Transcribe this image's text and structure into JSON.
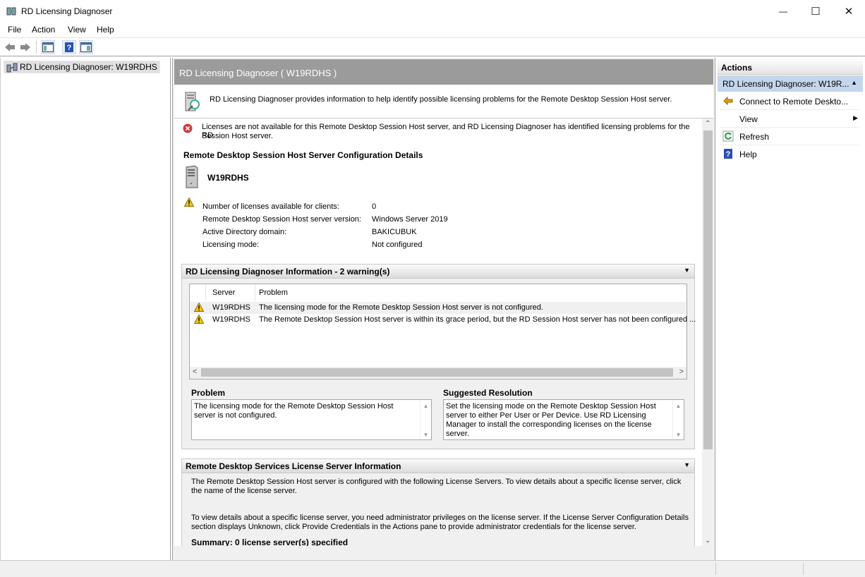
{
  "window": {
    "title": "RD Licensing Diagnoser",
    "minimize": "—",
    "maximize": "☐",
    "close": "✕"
  },
  "menu": [
    "File",
    "Action",
    "View",
    "Help"
  ],
  "tree": {
    "item": "RD Licensing Diagnoser: W19RDHS"
  },
  "center": {
    "header": "RD Licensing Diagnoser ( W19RDHS )",
    "intro": "RD Licensing Diagnoser provides information to help identify possible licensing problems for the Remote Desktop Session Host server.",
    "error_line1": "Licenses are not available for this Remote Desktop Session Host server, and RD Licensing Diagnoser has identified licensing problems for the RD",
    "error_line2": "Session Host server.",
    "config_title": "Remote Desktop Session Host Server Configuration Details",
    "server_name": "W19RDHS",
    "details": [
      {
        "label": "Number of licenses available for clients:",
        "value": "0"
      },
      {
        "label": "Remote Desktop Session Host server version:",
        "value": "Windows Server 2019"
      },
      {
        "label": "Active Directory domain:",
        "value": "BAKICUBUK"
      },
      {
        "label": "Licensing mode:",
        "value": "Not configured"
      }
    ],
    "diag": {
      "title": "RD Licensing Diagnoser Information - 2 warning(s)",
      "columns": [
        "Server",
        "Problem"
      ],
      "rows": [
        {
          "server": "W19RDHS",
          "problem": "The licensing mode for the Remote Desktop Session Host server is not configured."
        },
        {
          "server": "W19RDHS",
          "problem": "The Remote Desktop Session Host server is within its grace period, but the RD Session Host server has not been configured ..."
        }
      ],
      "problem_label": "Problem",
      "problem_text": "The licensing mode for the Remote Desktop Session Host server is not configured.",
      "resolution_label": "Suggested Resolution",
      "resolution_text": "Set the licensing mode on the Remote Desktop Session Host server to either Per User or Per Device. Use RD Licensing Manager to install the corresponding licenses on the license server."
    },
    "ls": {
      "title": "Remote Desktop Services License Server Information",
      "p1_l1": "The Remote Desktop Session Host server is configured with the following License Servers. To view details about a specific license server, click",
      "p1_l2": "the name of the license server.",
      "p2_l1": "To view details about a specific license server, you need administrator privileges on the license server. If the License Server Configuration Details",
      "p2_l2": "section displays Unknown, click Provide Credentials in the Actions pane to provide administrator credentials for the license server.",
      "summary": "Summary: 0 license server(s) specified"
    }
  },
  "actions": {
    "header": "Actions",
    "sub": "RD Licensing Diagnoser: W19R...",
    "items": [
      "Connect to Remote Deskto...",
      "View",
      "Refresh",
      "Help"
    ]
  }
}
